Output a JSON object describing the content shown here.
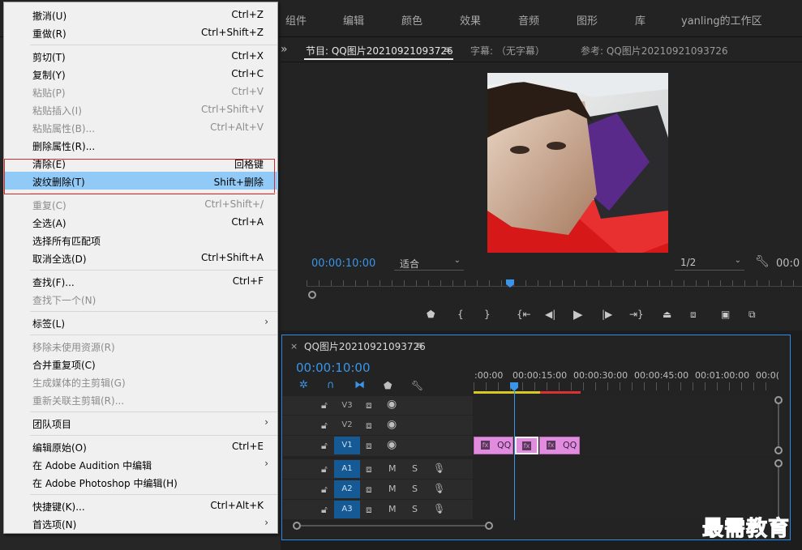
{
  "workspace_tabs": [
    "组件",
    "编辑",
    "颜色",
    "效果",
    "音频",
    "图形",
    "库",
    "yanling的工作区"
  ],
  "program": {
    "tab_label": "节目: QQ图片20210921093726",
    "menu_icon": "≡",
    "caption_tab": "字幕: （无字幕）",
    "reference_tab": "参考: QQ图片20210921093726",
    "timecode": "00:00:10:00",
    "fit": "适合",
    "resolution": "1/2",
    "timecode_right": "00:0",
    "panel_expand": "»"
  },
  "timeline": {
    "title": "QQ图片20210921093726",
    "menu_icon": "≡",
    "close": "×",
    "timecode": "00:00:10:00",
    "ruler": [
      ":00:00",
      "00:00:15:00",
      "00:00:30:00",
      "00:00:45:00",
      "00:01:00:00",
      "00:0("
    ],
    "tracks": [
      {
        "name": "V3"
      },
      {
        "name": "V2"
      },
      {
        "name": "V1"
      },
      {
        "name": "A1"
      },
      {
        "name": "A2"
      },
      {
        "name": "A3"
      }
    ],
    "clip_label": "QQ",
    "mute": "M",
    "solo": "S"
  },
  "edit_menu": [
    {
      "label": "撤消(U)",
      "shortcut": "Ctrl+Z"
    },
    {
      "label": "重做(R)",
      "shortcut": "Ctrl+Shift+Z"
    },
    {
      "label": "剪切(T)",
      "shortcut": "Ctrl+X"
    },
    {
      "label": "复制(Y)",
      "shortcut": "Ctrl+C"
    },
    {
      "label": "粘贴(P)",
      "shortcut": "Ctrl+V"
    },
    {
      "label": "粘贴插入(I)",
      "shortcut": "Ctrl+Shift+V"
    },
    {
      "label": "粘贴属性(B)...",
      "shortcut": "Ctrl+Alt+V"
    },
    {
      "label": "删除属性(R)...",
      "shortcut": ""
    },
    {
      "label": "清除(E)",
      "shortcut": "回格键"
    },
    {
      "label": "波纹删除(T)",
      "shortcut": "Shift+删除"
    },
    {
      "label": "重复(C)",
      "shortcut": "Ctrl+Shift+/"
    },
    {
      "label": "全选(A)",
      "shortcut": "Ctrl+A"
    },
    {
      "label": "选择所有匹配项",
      "shortcut": ""
    },
    {
      "label": "取消全选(D)",
      "shortcut": "Ctrl+Shift+A"
    },
    {
      "label": "查找(F)...",
      "shortcut": "Ctrl+F"
    },
    {
      "label": "查找下一个(N)",
      "shortcut": ""
    },
    {
      "label": "标签(L)",
      "shortcut": ""
    },
    {
      "label": "移除未使用资源(R)",
      "shortcut": ""
    },
    {
      "label": "合并重复项(C)",
      "shortcut": ""
    },
    {
      "label": "生成媒体的主剪辑(G)",
      "shortcut": ""
    },
    {
      "label": "重新关联主剪辑(R)...",
      "shortcut": ""
    },
    {
      "label": "团队项目",
      "shortcut": ""
    },
    {
      "label": "编辑原始(O)",
      "shortcut": "Ctrl+E"
    },
    {
      "label": "在 Adobe Audition 中编辑",
      "shortcut": ""
    },
    {
      "label": "在 Adobe Photoshop 中编辑(H)",
      "shortcut": ""
    },
    {
      "label": "快捷键(K)...",
      "shortcut": "Ctrl+Alt+K"
    },
    {
      "label": "首选项(N)",
      "shortcut": ""
    }
  ],
  "watermark": "最需教育",
  "colors": {
    "accent_blue": "#2d8ceb",
    "highlight": "#91c9f7",
    "clip": "#e28ce0",
    "timecode": "#3a95e8"
  }
}
